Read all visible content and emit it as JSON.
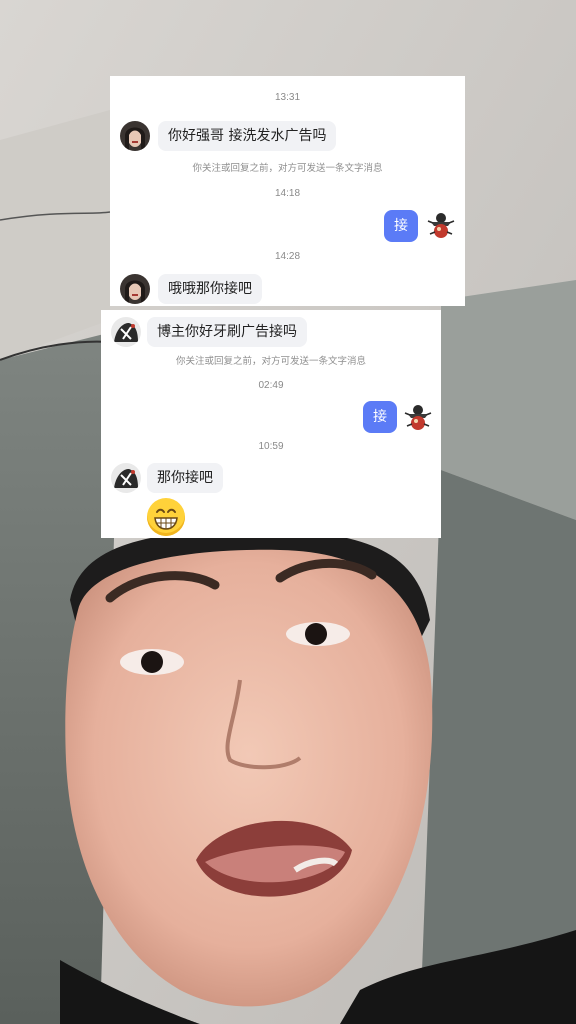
{
  "card1": {
    "messages": [
      {
        "kind": "time",
        "text": "13:31"
      },
      {
        "kind": "incoming",
        "text": "你好强哥 接洗发水广告吗"
      },
      {
        "kind": "notice",
        "text": "你关注或回复之前，对方可发送一条文字消息"
      },
      {
        "kind": "time",
        "text": "14:18"
      },
      {
        "kind": "outgoing",
        "text": "接"
      },
      {
        "kind": "time",
        "text": "14:28"
      },
      {
        "kind": "incoming",
        "text": "哦哦那你接吧"
      }
    ]
  },
  "card2": {
    "messages": [
      {
        "kind": "incoming",
        "text": "博主你好牙刷广告接吗"
      },
      {
        "kind": "notice",
        "text": "你关注或回复之前，对方可发送一条文字消息"
      },
      {
        "kind": "time",
        "text": "02:49"
      },
      {
        "kind": "outgoing",
        "text": "接"
      },
      {
        "kind": "time",
        "text": "10:59"
      },
      {
        "kind": "incoming",
        "text": "那你接吧"
      },
      {
        "kind": "emoji",
        "icon": "grinning-face-emoji"
      }
    ]
  },
  "colors": {
    "outgoing_bubble": "#5b7bf6",
    "incoming_bubble": "#f1f2f5",
    "card_bg": "#ffffff"
  }
}
